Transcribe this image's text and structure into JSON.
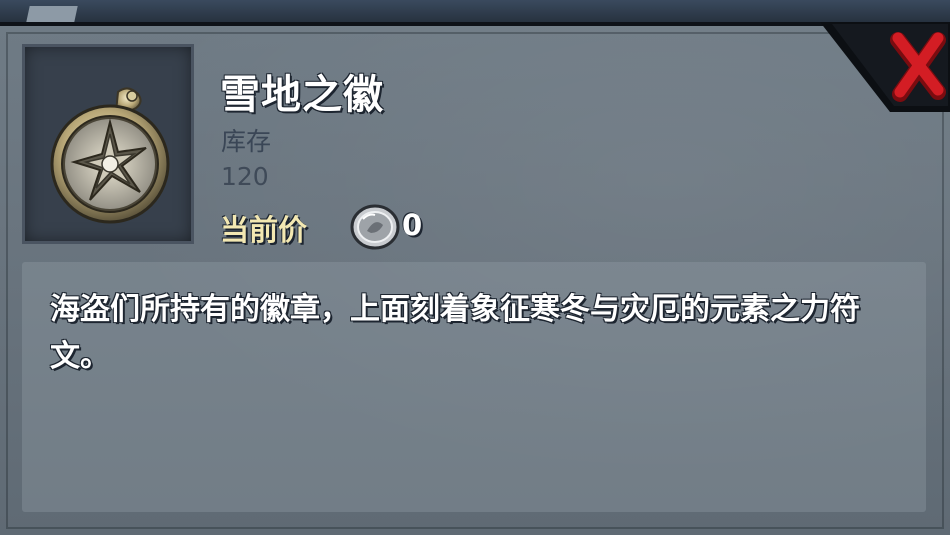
{
  "item": {
    "name": "雪地之徽",
    "icon": "snow-emblem-icon",
    "stock_label": "库存",
    "stock_value": "120",
    "price_label": "当前价",
    "price_currency_icon": "silver-coin-icon",
    "price_value": "0",
    "description": "海盗们所持有的徽章，上面刻着象征寒冬与灾厄的元素之力符文。"
  },
  "close_icon": "close-x-icon",
  "colors": {
    "panel": "#6a7580",
    "price_label": "#f3e8b2",
    "close_x": "#d31d24"
  }
}
